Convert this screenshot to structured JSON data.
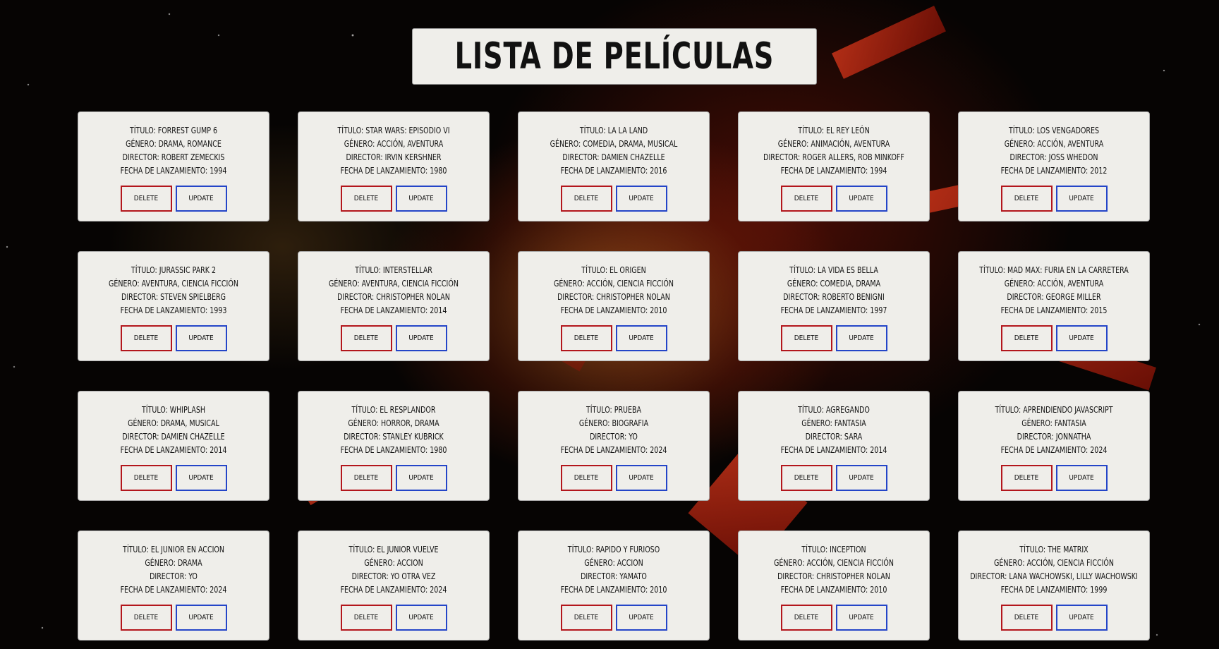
{
  "page": {
    "title": "LISTA DE PELÍCULAS"
  },
  "labels": {
    "titulo": "TÍTULO:",
    "genero": "GÉNERO:",
    "director": "DIRECTOR:",
    "fecha": "FECHA DE LANZAMIENTO:",
    "delete": "DELETE",
    "update": "UPDATE"
  },
  "colors": {
    "delete_border": "#b3161c",
    "update_border": "#2445c8",
    "card_bg": "#efeeea"
  },
  "movies": [
    {
      "titulo": "TÍTULO: FORREST GUMP 6",
      "genero": "GÉNERO: DRAMA, ROMANCE",
      "director": "DIRECTOR: ROBERT ZEMECKIS",
      "fecha": "FECHA DE LANZAMIENTO: 1994"
    },
    {
      "titulo": "TÍTULO: STAR WARS: EPISODIO VI",
      "genero": "GÉNERO: ACCIÓN, AVENTURA",
      "director": "DIRECTOR: IRVIN KERSHNER",
      "fecha": "FECHA DE LANZAMIENTO: 1980"
    },
    {
      "titulo": "TÍTULO: LA LA LAND",
      "genero": "GÉNERO: COMEDIA, DRAMA, MUSICAL",
      "director": "DIRECTOR: DAMIEN CHAZELLE",
      "fecha": "FECHA DE LANZAMIENTO: 2016"
    },
    {
      "titulo": "TÍTULO: EL REY LEÓN",
      "genero": "GÉNERO: ANIMACIÓN, AVENTURA",
      "director": "DIRECTOR: ROGER ALLERS, ROB MINKOFF",
      "fecha": "FECHA DE LANZAMIENTO: 1994"
    },
    {
      "titulo": "TÍTULO: LOS VENGADORES",
      "genero": "GÉNERO: ACCIÓN, AVENTURA",
      "director": "DIRECTOR: JOSS WHEDON",
      "fecha": "FECHA DE LANZAMIENTO: 2012"
    },
    {
      "titulo": "TÍTULO: JURASSIC PARK 2",
      "genero": "GÉNERO: AVENTURA, CIENCIA FICCIÓN",
      "director": "DIRECTOR: STEVEN SPIELBERG",
      "fecha": "FECHA DE LANZAMIENTO: 1993"
    },
    {
      "titulo": "TÍTULO: INTERSTELLAR",
      "genero": "GÉNERO: AVENTURA, CIENCIA FICCIÓN",
      "director": "DIRECTOR: CHRISTOPHER NOLAN",
      "fecha": "FECHA DE LANZAMIENTO: 2014"
    },
    {
      "titulo": "TÍTULO: EL ORIGEN",
      "genero": "GÉNERO: ACCIÓN, CIENCIA FICCIÓN",
      "director": "DIRECTOR: CHRISTOPHER NOLAN",
      "fecha": "FECHA DE LANZAMIENTO: 2010"
    },
    {
      "titulo": "TÍTULO: LA VIDA ES BELLA",
      "genero": "GÉNERO: COMEDIA, DRAMA",
      "director": "DIRECTOR: ROBERTO BENIGNI",
      "fecha": "FECHA DE LANZAMIENTO: 1997"
    },
    {
      "titulo": "TÍTULO: MAD MAX: FURIA EN LA CARRETERA",
      "genero": "GÉNERO: ACCIÓN, AVENTURA",
      "director": "DIRECTOR: GEORGE MILLER",
      "fecha": "FECHA DE LANZAMIENTO: 2015"
    },
    {
      "titulo": "TÍTULO: WHIPLASH",
      "genero": "GÉNERO: DRAMA, MUSICAL",
      "director": "DIRECTOR: DAMIEN CHAZELLE",
      "fecha": "FECHA DE LANZAMIENTO: 2014"
    },
    {
      "titulo": "TÍTULO: EL RESPLANDOR",
      "genero": "GÉNERO: HORROR, DRAMA",
      "director": "DIRECTOR: STANLEY KUBRICK",
      "fecha": "FECHA DE LANZAMIENTO: 1980"
    },
    {
      "titulo": "TÍTULO: PRUEBA",
      "genero": "GÉNERO: BIOGRAFIA",
      "director": "DIRECTOR: YO",
      "fecha": "FECHA DE LANZAMIENTO: 2024"
    },
    {
      "titulo": "TÍTULO: AGREGANDO",
      "genero": "GÉNERO: FANTASIA",
      "director": "DIRECTOR: SARA",
      "fecha": "FECHA DE LANZAMIENTO: 2014"
    },
    {
      "titulo": "TÍTULO: APRENDIENDO JAVASCRIPT",
      "genero": "GÉNERO: FANTASIA",
      "director": "DIRECTOR: JONNATHA",
      "fecha": "FECHA DE LANZAMIENTO: 2024"
    },
    {
      "titulo": "TÍTULO: EL JUNIOR EN ACCION",
      "genero": "GÉNERO: DRAMA",
      "director": "DIRECTOR: YO",
      "fecha": "FECHA DE LANZAMIENTO: 2024"
    },
    {
      "titulo": "TÍTULO: EL JUNIOR VUELVE",
      "genero": "GÉNERO: ACCION",
      "director": "DIRECTOR: YO OTRA VEZ",
      "fecha": "FECHA DE LANZAMIENTO: 2024"
    },
    {
      "titulo": "TÍTULO: RAPIDO Y FURIOSO",
      "genero": "GÉNERO: ACCION",
      "director": "DIRECTOR: YAMATO",
      "fecha": "FECHA DE LANZAMIENTO: 2010"
    },
    {
      "titulo": "TÍTULO: INCEPTION",
      "genero": "GÉNERO: ACCIÓN, CIENCIA FICCIÓN",
      "director": "DIRECTOR: CHRISTOPHER NOLAN",
      "fecha": "FECHA DE LANZAMIENTO: 2010"
    },
    {
      "titulo": "TÍTULO: THE MATRIX",
      "genero": "GÉNERO: ACCIÓN, CIENCIA FICCIÓN",
      "director": "DIRECTOR: LANA WACHOWSKI, LILLY WACHOWSKI",
      "fecha": "FECHA DE LANZAMIENTO: 1999"
    }
  ]
}
